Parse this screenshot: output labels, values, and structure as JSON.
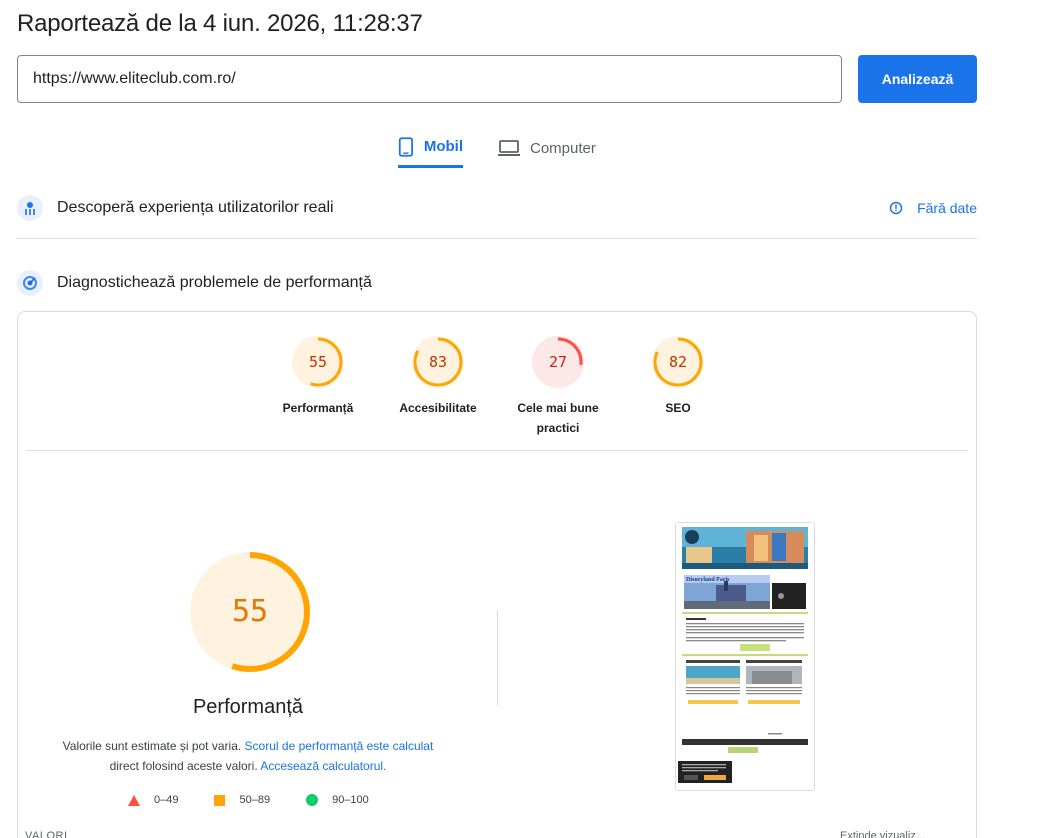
{
  "header": {
    "title": "Raportează de la 4 iun. 2026, 11:28:37"
  },
  "search": {
    "url_value": "https://www.eliteclub.com.ro/",
    "analyze_label": "Analizează"
  },
  "tabs": [
    {
      "label": "Mobil",
      "icon": "phone-icon",
      "active": true
    },
    {
      "label": "Computer",
      "icon": "laptop-icon",
      "active": false
    }
  ],
  "crux": {
    "title": "Descoperă experiența utilizatorilor reali",
    "status": "Fără date"
  },
  "diagnose": {
    "title": "Diagnostichează problemele de performanță"
  },
  "scores": [
    {
      "value": "55",
      "label": "Performanță",
      "score": 55,
      "color": "#ffa400",
      "text_color": "#c33300"
    },
    {
      "value": "83",
      "label": "Accesibilitate",
      "score": 83,
      "color": "#ffa400",
      "text_color": "#c33300"
    },
    {
      "value": "27",
      "label": "Cele mai bune practici",
      "score": 27,
      "color": "#ff4e42",
      "text_color": "#c5221f"
    },
    {
      "value": "82",
      "label": "SEO",
      "score": 82,
      "color": "#ffa400",
      "text_color": "#c33300"
    }
  ],
  "performance": {
    "value": "55",
    "label": "Performanță",
    "estimate_text": "Valorile sunt estimate și pot varia.",
    "calc_link": "Scorul de performanță este calculat",
    "direct_text": "direct folosind aceste valori.",
    "calculator_link": "Accesează calculatorul."
  },
  "legend": [
    {
      "range": "0–49",
      "shape": "triangle",
      "color": "#ff4e42"
    },
    {
      "range": "50–89",
      "shape": "square",
      "color": "#ffa400"
    },
    {
      "range": "90–100",
      "shape": "circle",
      "color": "#0cce6b"
    }
  ],
  "thumbnail": {
    "banner_text": "Disneyland Paris"
  },
  "footer": {
    "values_label": "VALORI",
    "right_text": "Extinde vizualiz..."
  }
}
